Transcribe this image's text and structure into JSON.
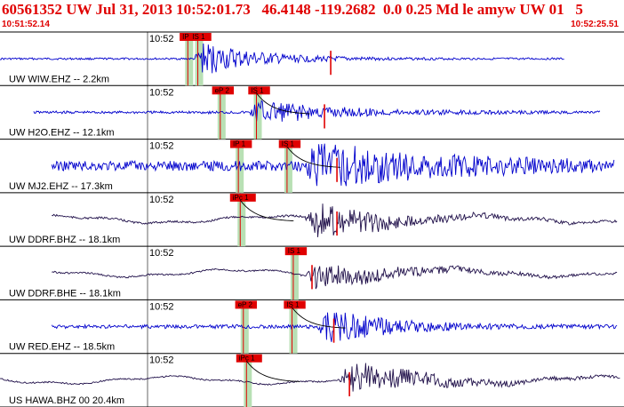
{
  "header": {
    "title": "60561352 UW Jul 31, 2013 10:52:01.73   46.4148 -119.2682  0.0 0.25 Md le amyw UW 01   5",
    "time_start": "10:51:52.14",
    "time_end": "10:52:25.51"
  },
  "colors": {
    "header_text": "#e00000",
    "trace_blue": "#0000cc",
    "trace_dark": "#20104a",
    "pick_red": "#e00000",
    "pick_window": "#b8e0b4",
    "coda_curve": "#000000"
  },
  "chart_data": {
    "type": "line",
    "time_range": [
      "10:51:52.14",
      "10:52:25.51"
    ],
    "minute_mark_label": "10:52",
    "panels": [
      {
        "label": "UW WIW.EHZ -- 2.2km",
        "color": "blue",
        "trace_start": 0.0,
        "trace_end": 0.905,
        "event_at": 0.322,
        "amp": 0.36,
        "noise": 0.05,
        "decay": 0.09,
        "picks": [
          {
            "label": "IP 1",
            "at": 0.301,
            "window": true
          },
          {
            "label": "IS 1",
            "at": 0.317,
            "window": true
          }
        ],
        "coda": false,
        "coda_marker": 0.53
      },
      {
        "label": "UW H2O.EHZ -- 12.1km",
        "color": "blue",
        "trace_start": 0.054,
        "trace_end": 0.962,
        "event_at": 0.41,
        "amp": 0.26,
        "noise": 0.1,
        "decay": 0.12,
        "picks": [
          {
            "label": "eP 2",
            "at": 0.353,
            "window": true
          },
          {
            "label": "IS 1",
            "at": 0.411,
            "window": true
          }
        ],
        "coda": true,
        "coda_marker": 0.52
      },
      {
        "label": "UW MJ2.EHZ -- 17.3km",
        "color": "blue",
        "trace_start": 0.083,
        "trace_end": 0.985,
        "event_at": 0.5,
        "amp": 0.42,
        "noise": 0.22,
        "decay": 0.2,
        "picks": [
          {
            "label": "IP 1",
            "at": 0.382,
            "window": true
          },
          {
            "label": "IS 1",
            "at": 0.46,
            "window": true
          }
        ],
        "coda": true,
        "coda_marker": 0.54
      },
      {
        "label": "UW DDRF.BHZ -- 18.1km",
        "color": "dark",
        "trace_start": 0.083,
        "trace_end": 0.99,
        "event_at": 0.5,
        "amp": 0.38,
        "noise": 0.05,
        "decay": 0.12,
        "picks": [
          {
            "label": "iPc 1",
            "at": 0.385,
            "window": true
          }
        ],
        "coda": true,
        "coda_marker": 0.54
      },
      {
        "label": "UW DDRF.BHE -- 18.1km",
        "color": "dark",
        "trace_start": 0.083,
        "trace_end": 0.99,
        "event_at": 0.5,
        "amp": 0.26,
        "noise": 0.06,
        "decay": 0.14,
        "picks": [
          {
            "label": "IS 1",
            "at": 0.47,
            "window": true
          }
        ],
        "coda": false,
        "coda_marker": 0.5
      },
      {
        "label": "UW RED.EHZ -- 18.5km",
        "color": "blue",
        "trace_start": 0.083,
        "trace_end": 0.99,
        "event_at": 0.52,
        "amp": 0.36,
        "noise": 0.1,
        "decay": 0.1,
        "picks": [
          {
            "label": "eP 2",
            "at": 0.39,
            "window": true
          },
          {
            "label": "IS 1",
            "at": 0.468,
            "window": true
          }
        ],
        "coda": true,
        "coda_marker": 0.535
      },
      {
        "label": "US HAWA.BHZ 00 20.4km",
        "color": "dark",
        "trace_start": 0.0,
        "trace_end": 0.995,
        "event_at": 0.555,
        "amp": 0.34,
        "noise": 0.04,
        "decay": 0.13,
        "picks": [
          {
            "label": "iPc 1",
            "at": 0.395,
            "window": true
          }
        ],
        "coda": true,
        "coda_marker": 0.56
      }
    ]
  }
}
